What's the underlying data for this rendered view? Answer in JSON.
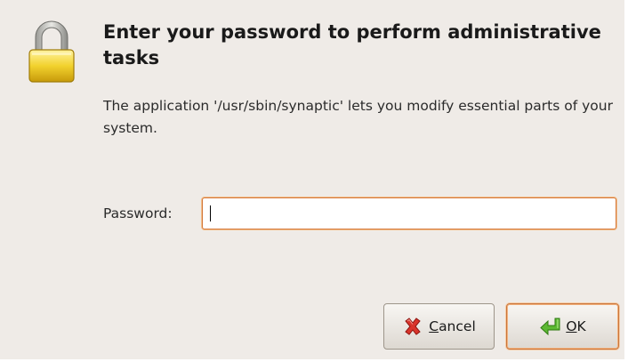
{
  "dialog": {
    "title": "Enter your password to perform administrative tasks",
    "message": "The application '/usr/sbin/synaptic' lets you modify essential parts of your system.",
    "password_label": "Password:",
    "password_value": "",
    "icon": "lock-icon"
  },
  "buttons": {
    "cancel": {
      "mnemonic": "C",
      "rest": "ancel",
      "icon": "cancel-x-icon",
      "color": "#d9342b"
    },
    "ok": {
      "mnemonic": "O",
      "rest": "K",
      "icon": "enter-arrow-icon",
      "color": "#4ea52b"
    }
  },
  "colors": {
    "background": "#efebe7",
    "focus_border": "#d4773a"
  }
}
